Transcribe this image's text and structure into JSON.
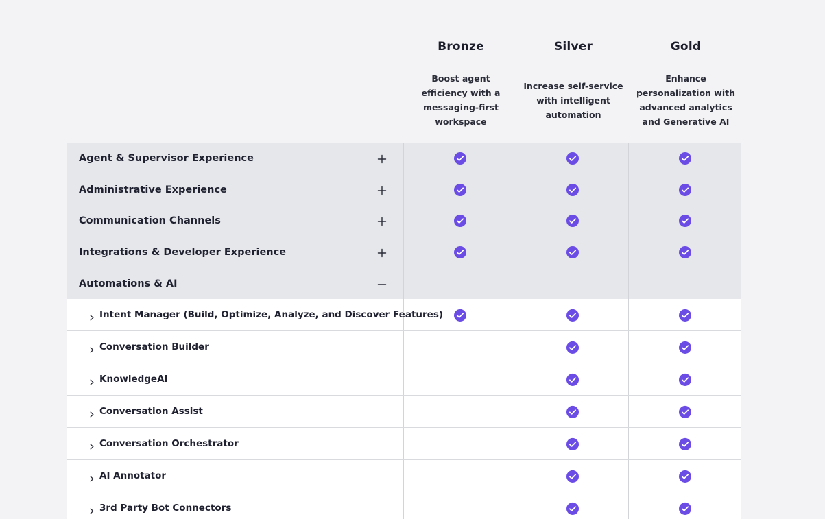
{
  "plans": [
    {
      "name": "Bronze",
      "description": "Boost agent efficiency with a messaging-first workspace"
    },
    {
      "name": "Silver",
      "description": "Increase self-service with intelligent automation"
    },
    {
      "name": "Gold",
      "description": "Enhance personalization with advanced analytics and Generative AI"
    }
  ],
  "categories": [
    {
      "label": "Agent & Supervisor Experience",
      "toggle_icon": "plus-icon",
      "included": [
        true,
        true,
        true
      ]
    },
    {
      "label": "Administrative Experience",
      "toggle_icon": "plus-icon",
      "included": [
        true,
        true,
        true
      ]
    },
    {
      "label": "Communication Channels",
      "toggle_icon": "plus-icon",
      "included": [
        true,
        true,
        true
      ]
    },
    {
      "label": "Integrations & Developer Experience",
      "toggle_icon": "plus-icon",
      "included": [
        true,
        true,
        true
      ]
    },
    {
      "label": "Automations & AI",
      "toggle_icon": "minus-icon",
      "included": [
        false,
        false,
        false
      ]
    }
  ],
  "features": [
    {
      "label": "Intent Manager (Build, Optimize, Analyze, and Discover Features)",
      "included": [
        true,
        true,
        true
      ]
    },
    {
      "label": "Conversation Builder",
      "included": [
        false,
        true,
        true
      ]
    },
    {
      "label": "KnowledgeAI",
      "included": [
        false,
        true,
        true
      ]
    },
    {
      "label": "Conversation Assist",
      "included": [
        false,
        true,
        true
      ]
    },
    {
      "label": "Conversation Orchestrator",
      "included": [
        false,
        true,
        true
      ]
    },
    {
      "label": "AI Annotator",
      "included": [
        false,
        true,
        true
      ]
    },
    {
      "label": "3rd Party Bot Connectors",
      "included": [
        false,
        true,
        true
      ]
    }
  ],
  "icons": {
    "check": "check-circle-icon",
    "expand": "plus-icon",
    "collapse": "minus-icon",
    "feature_expand": "chevron-right-icon"
  },
  "colors": {
    "check_fill": "#6b4de6",
    "category_bg": "#e6e7eb",
    "page_bg": "#f3f3f5"
  }
}
